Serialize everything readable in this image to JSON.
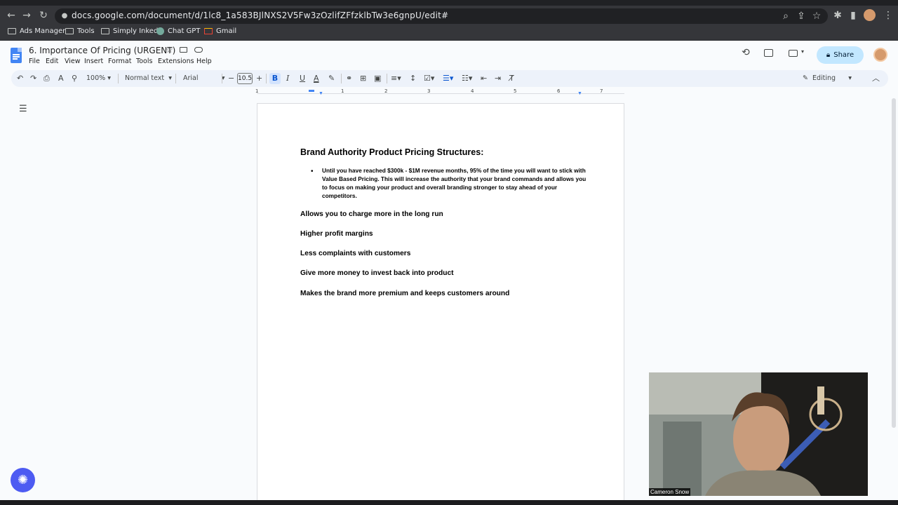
{
  "browser": {
    "url": "docs.google.com/document/d/1lc8_1a583BJlNXS2V5Fw3zOzlifZFfzklbTw3e6gnpU/edit#",
    "bookmarks": [
      {
        "label": "Ads Manager",
        "icon": "folder-icon"
      },
      {
        "label": "Tools",
        "icon": "folder-icon"
      },
      {
        "label": "Simply Inked",
        "icon": "folder-icon"
      },
      {
        "label": "Chat GPT",
        "icon": "chatgpt-icon"
      },
      {
        "label": "Gmail",
        "icon": "gmail-icon"
      }
    ]
  },
  "docs": {
    "title": "6. Importance Of Pricing (URGENT)",
    "menus": [
      "File",
      "Edit",
      "View",
      "Insert",
      "Format",
      "Tools",
      "Extensions",
      "Help"
    ],
    "share_label": "Share",
    "toolbar": {
      "zoom": "100%",
      "style": "Normal text",
      "font": "Arial",
      "font_size": "10.5",
      "mode": "Editing"
    },
    "ruler_numbers": [
      "1",
      "1",
      "2",
      "3",
      "4",
      "5",
      "6",
      "7"
    ]
  },
  "document": {
    "heading": "Brand Authority Product Pricing Structures:",
    "bullet": "Until you have reached $300k - $1M revenue months, 95% of the time you will want to stick with Value Based Pricing. This will increase the authority that your brand commands and allows you to focus on making your product and overall branding stronger to stay ahead of your competitors.",
    "paragraphs": [
      "Allows you to charge more in the long run",
      "Higher profit margins",
      "Less complaints with customers",
      "Give more money to invest back into product",
      "Makes the brand more premium and keeps customers around"
    ]
  },
  "webcam": {
    "name": "Cameron Snow"
  },
  "colors": {
    "share_bg": "#c2e7ff",
    "toolbar_bg": "#edf2fa",
    "docs_blue": "#4285f4",
    "fab": "#4d5bf2"
  }
}
